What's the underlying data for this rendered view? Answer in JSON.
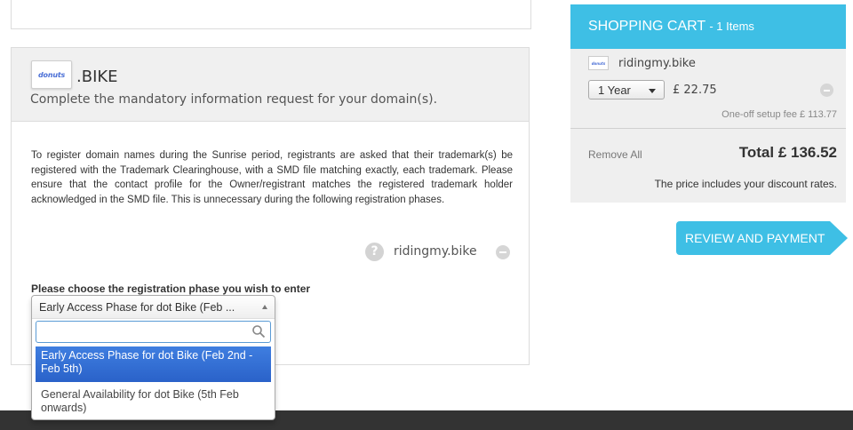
{
  "domain_panel": {
    "logo_text": "donuts",
    "tld": ".BIKE",
    "subtitle": "Complete the mandatory information request for your domain(s).",
    "sunrise_text": "To register domain names during the Sunrise period, registrants are asked that their trademark(s) be registered with the Trademark Clearinghouse, with a SMD file matching exactly, each trademark. Please ensure that the contact profile for the Owner/registrant matches the registered trademark holder acknowledged in the SMD file. This is unnecessary during the following registration phases.",
    "domain": "ridingmy.bike",
    "help_glyph": "?",
    "phase_label": "Please choose the registration phase you wish to enter",
    "phase_select": {
      "selected_value": "Early Access Phase for dot Bike (Feb ...",
      "search_value": "",
      "options": [
        "Early Access Phase for dot Bike (Feb 2nd - Feb 5th)",
        "General Availability for dot Bike (5th Feb onwards)"
      ],
      "highlighted_index": 0
    }
  },
  "cart": {
    "title": "SHOPPING CART",
    "count_label": "- 1 Items",
    "item": {
      "logo_text": "donuts",
      "domain": "ridingmy.bike",
      "period": "1 Year",
      "price": "£ 22.75",
      "setup_fee": "One-off setup fee £ 113.77"
    },
    "remove_all": "Remove All",
    "total": "Total £ 136.52",
    "discount_note": "The price includes your discount rates."
  },
  "pay_button": {
    "label": "REVIEW AND PAYMENT"
  },
  "colors": {
    "accent": "#3ebfe5",
    "highlight": "#3875d7",
    "footer": "#333333"
  }
}
